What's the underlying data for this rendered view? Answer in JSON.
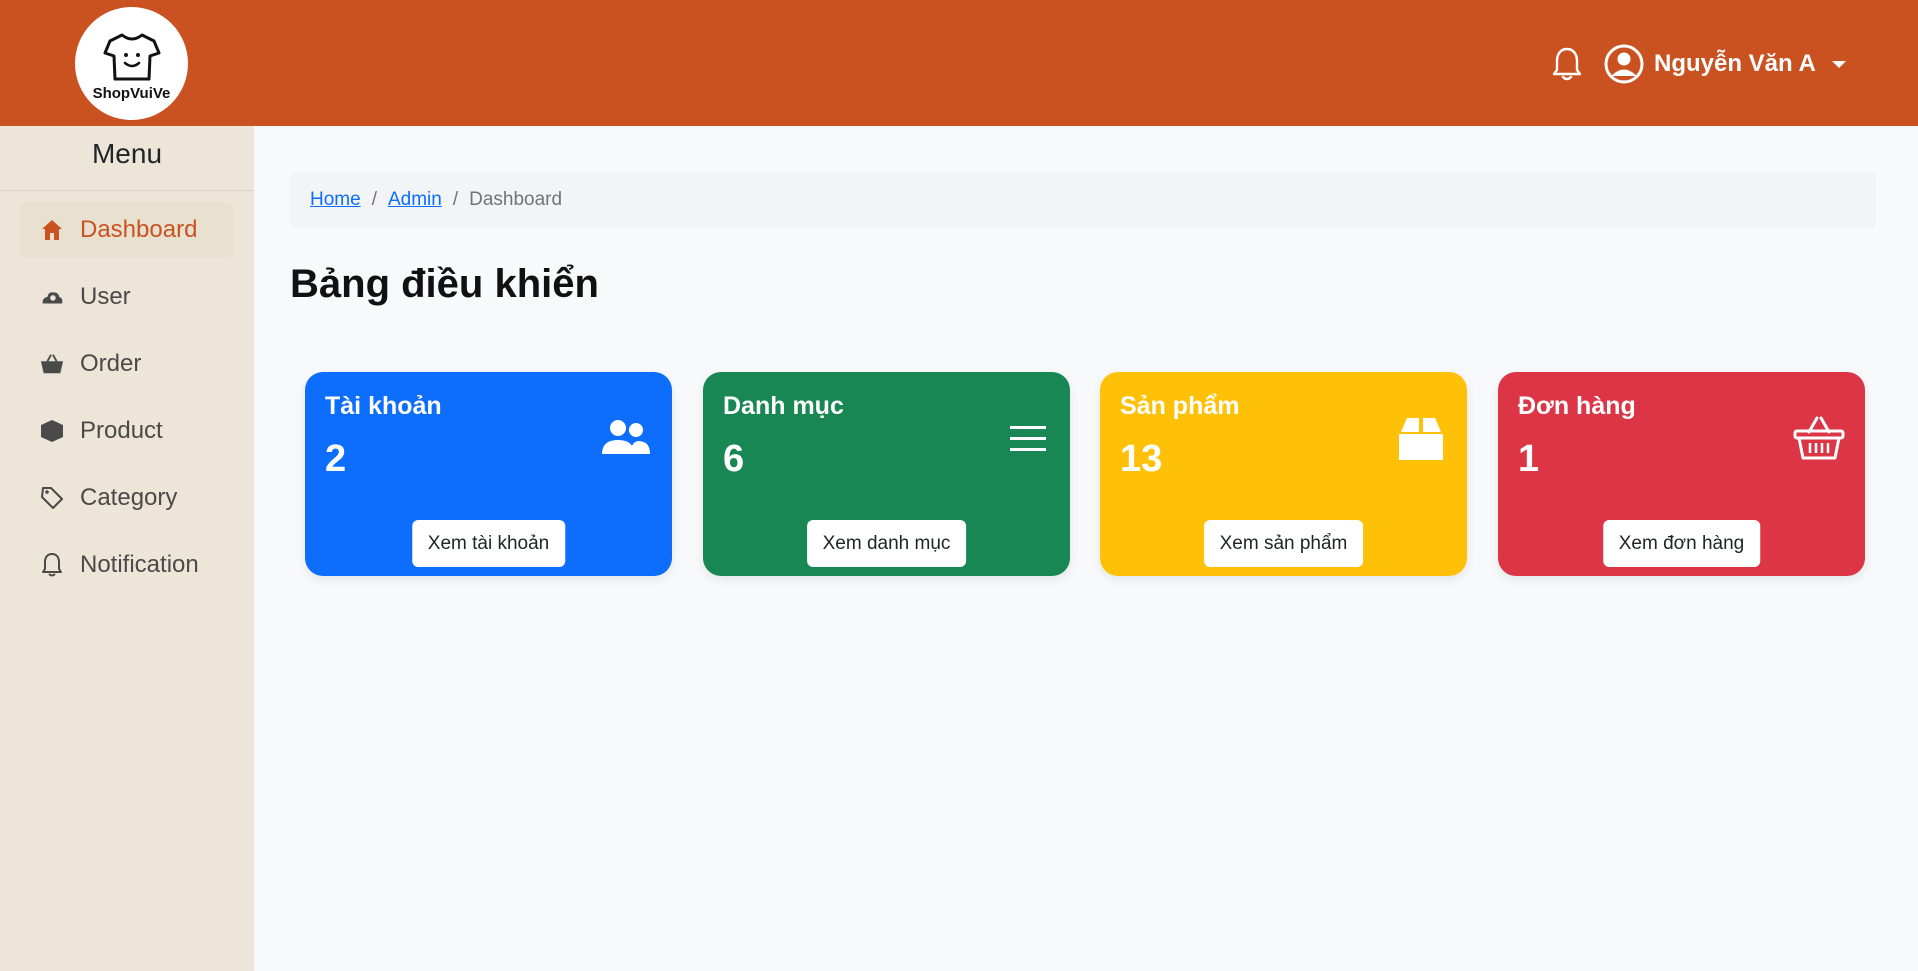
{
  "header": {
    "logo_text": "ShopVuiVe",
    "logo_icon": "tshirt-smile-icon",
    "notification_icon": "bell-icon",
    "user_icon": "user-circle-icon",
    "user_name": "Nguyễn Văn A",
    "background_color": "#ca5221"
  },
  "sidebar": {
    "title": "Menu",
    "items": [
      {
        "label": "Dashboard",
        "icon": "house-icon",
        "active": true
      },
      {
        "label": "User",
        "icon": "user-cloud-icon",
        "active": false
      },
      {
        "label": "Order",
        "icon": "basket-icon",
        "active": false
      },
      {
        "label": "Product",
        "icon": "box-icon",
        "active": false
      },
      {
        "label": "Category",
        "icon": "tag-icon",
        "active": false
      },
      {
        "label": "Notification",
        "icon": "bell-icon",
        "active": false
      }
    ]
  },
  "breadcrumb": {
    "items": [
      "Home",
      "Admin",
      "Dashboard"
    ],
    "separator": "/"
  },
  "page": {
    "title": "Bảng điều khiển"
  },
  "cards": [
    {
      "title": "Tài khoản",
      "value": "2",
      "button": "Xem tài khoản",
      "icon": "users-icon",
      "color": "#0d6efd"
    },
    {
      "title": "Danh mục",
      "value": "6",
      "button": "Xem danh mục",
      "icon": "list-icon",
      "color": "#198754"
    },
    {
      "title": "Sản phẩm",
      "value": "13",
      "button": "Xem sản phẩm",
      "icon": "box-icon",
      "color": "#ffc107"
    },
    {
      "title": "Đơn hàng",
      "value": "1",
      "button": "Xem đơn hàng",
      "icon": "basket-icon",
      "color": "#dc3545"
    }
  ]
}
